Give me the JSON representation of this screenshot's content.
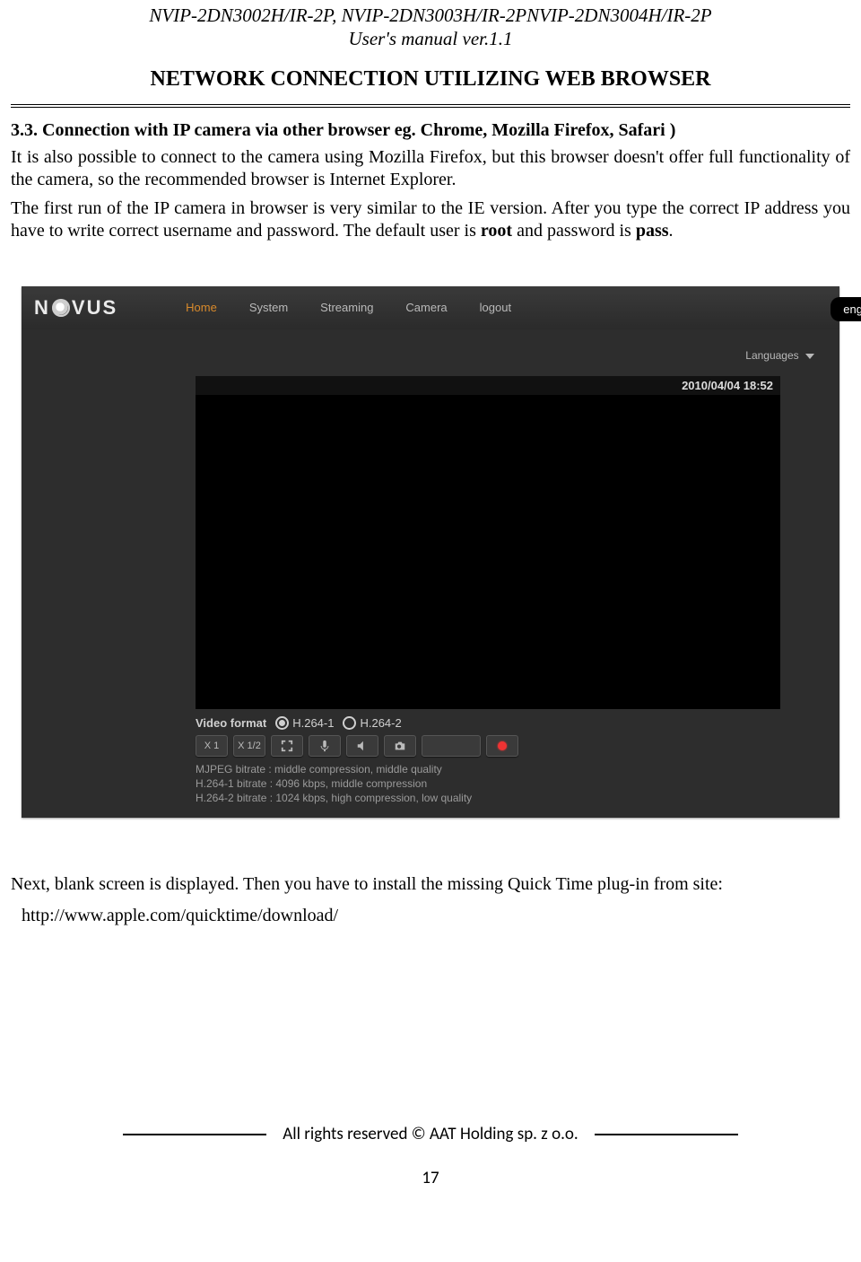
{
  "doc": {
    "header_line1": "NVIP-2DN3002H/IR-2P, NVIP-2DN3003H/IR-2PNVIP-2DN3004H/IR-2P",
    "header_line2": "User's manual ver.1.1",
    "section_title": "NETWORK CONNECTION UTILIZING WEB BROWSER",
    "subsection_title": "3.3. Connection with IP camera via other browser eg. Chrome, Mozilla Firefox, Safari )",
    "para1": "It is also possible to connect to the camera using Mozilla Firefox, but this browser doesn't offer full functionality of the camera, so the recommended browser is Internet Explorer.",
    "para2_pre": "The first run of the IP camera in browser is very similar to  the IE version. After you type the correct IP address you have to write correct username and password. The default user is ",
    "para2_user": "root",
    "para2_mid": " and password is ",
    "para2_pass": "pass",
    "para2_end": ".",
    "after_text": "Next, blank screen is displayed. Then you have to install the missing Quick Time plug-in from site:",
    "url_text": "http://www.apple.com/quicktime/download/",
    "footer": "All rights reserved © AAT Holding sp. z o.o.",
    "page_number": "17",
    "lang_tab": "eng"
  },
  "shot": {
    "logo_left": "N",
    "logo_right": "VUS",
    "nav": {
      "home": "Home",
      "system": "System",
      "streaming": "Streaming",
      "camera": "Camera",
      "logout": "logout"
    },
    "languages_label": "Languages",
    "timestamp": "2010/04/04 18:52",
    "format_label": "Video format",
    "radio1": "H.264-1",
    "radio2": "H.264-2",
    "toolbar": {
      "x1": "X 1",
      "x1_2": "X 1/2"
    },
    "info1": "MJPEG bitrate : middle compression, middle quality",
    "info2": "H.264-1 bitrate :  4096 kbps, middle compression",
    "info3": "H.264-2 bitrate :  1024 kbps, high compression, low quality"
  }
}
